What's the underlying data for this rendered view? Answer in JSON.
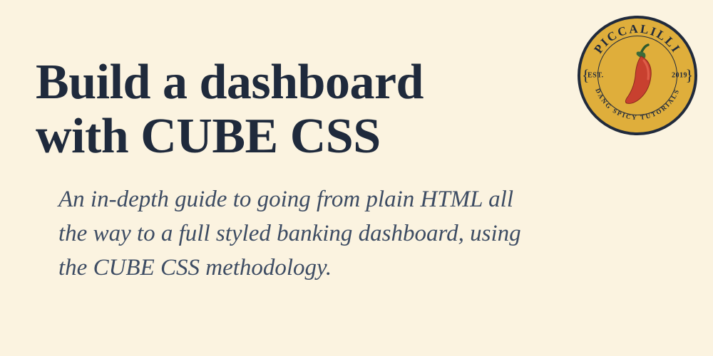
{
  "hero": {
    "title_line1": "Build a dashboard",
    "title_line2": "with CUBE CSS",
    "subtitle": "An in-depth guide to going from plain HTML all the way to a full styled banking dashboard, using the CUBE CSS methodology."
  },
  "badge": {
    "brand": "PICCALILLI",
    "tagline": "DANG SPICY TUTORIALS",
    "est_label": "EST.",
    "year": "2019"
  }
}
